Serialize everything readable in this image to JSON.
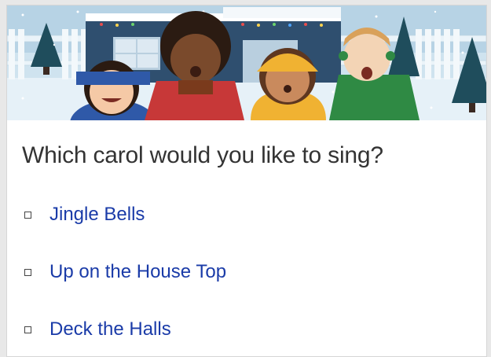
{
  "survey": {
    "banner_alt": "Carolers singing in front of a snowy house",
    "question": "Which carol would you like to sing?",
    "options": [
      {
        "label": "Jingle Bells",
        "checked": false
      },
      {
        "label": "Up on the House Top",
        "checked": false
      },
      {
        "label": "Deck the Halls",
        "checked": false
      }
    ]
  },
  "colors": {
    "sky": "#cfe3ef",
    "snow": "#ffffff",
    "house": "#2f4f6f",
    "link": "#1a3ba8",
    "text": "#333333"
  }
}
